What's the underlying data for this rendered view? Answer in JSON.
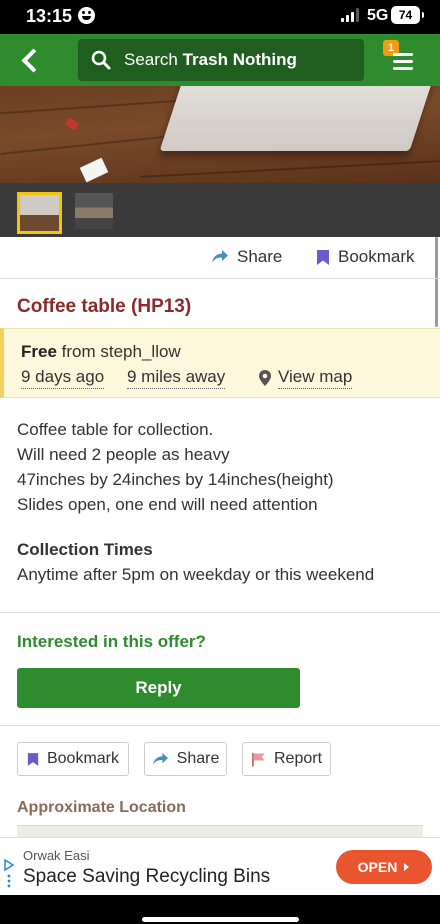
{
  "status_bar": {
    "time": "13:15",
    "network": "5G",
    "battery": "74"
  },
  "nav": {
    "search_placeholder_prefix": "Search",
    "search_placeholder_brand": "Trash Nothing",
    "notification_count": "1"
  },
  "actions": {
    "share": "Share",
    "bookmark": "Bookmark"
  },
  "listing": {
    "title": "Coffee table (HP13)",
    "offer_type": "Free",
    "from_text": "from steph_llow",
    "age": "9 days ago",
    "distance": "9 miles away",
    "map_link": "View map",
    "description": [
      "Coffee table for collection.",
      "Will need 2 people as heavy",
      "47inches by 24inches by 14inches(height)",
      "Slides open, one end will need attention"
    ],
    "collection_heading": "Collection Times",
    "collection_text": "Anytime after 5pm on weekday or this weekend"
  },
  "reply_section": {
    "heading": "Interested in this offer?",
    "reply_label": "Reply"
  },
  "buttons": {
    "bookmark": "Bookmark",
    "share": "Share",
    "report": "Report"
  },
  "location": {
    "heading": "Approximate Location"
  },
  "ad": {
    "source": "Orwak Easi",
    "title": "Space Saving Recycling Bins",
    "cta": "OPEN"
  },
  "colors": {
    "brand_green": "#2e8b2e",
    "title_red": "#8b2a2a",
    "info_bg": "#fdf7dc",
    "bookmark_purple": "#6a5acd",
    "share_blue": "#4a8fb8",
    "ad_cta": "#e8552f"
  }
}
